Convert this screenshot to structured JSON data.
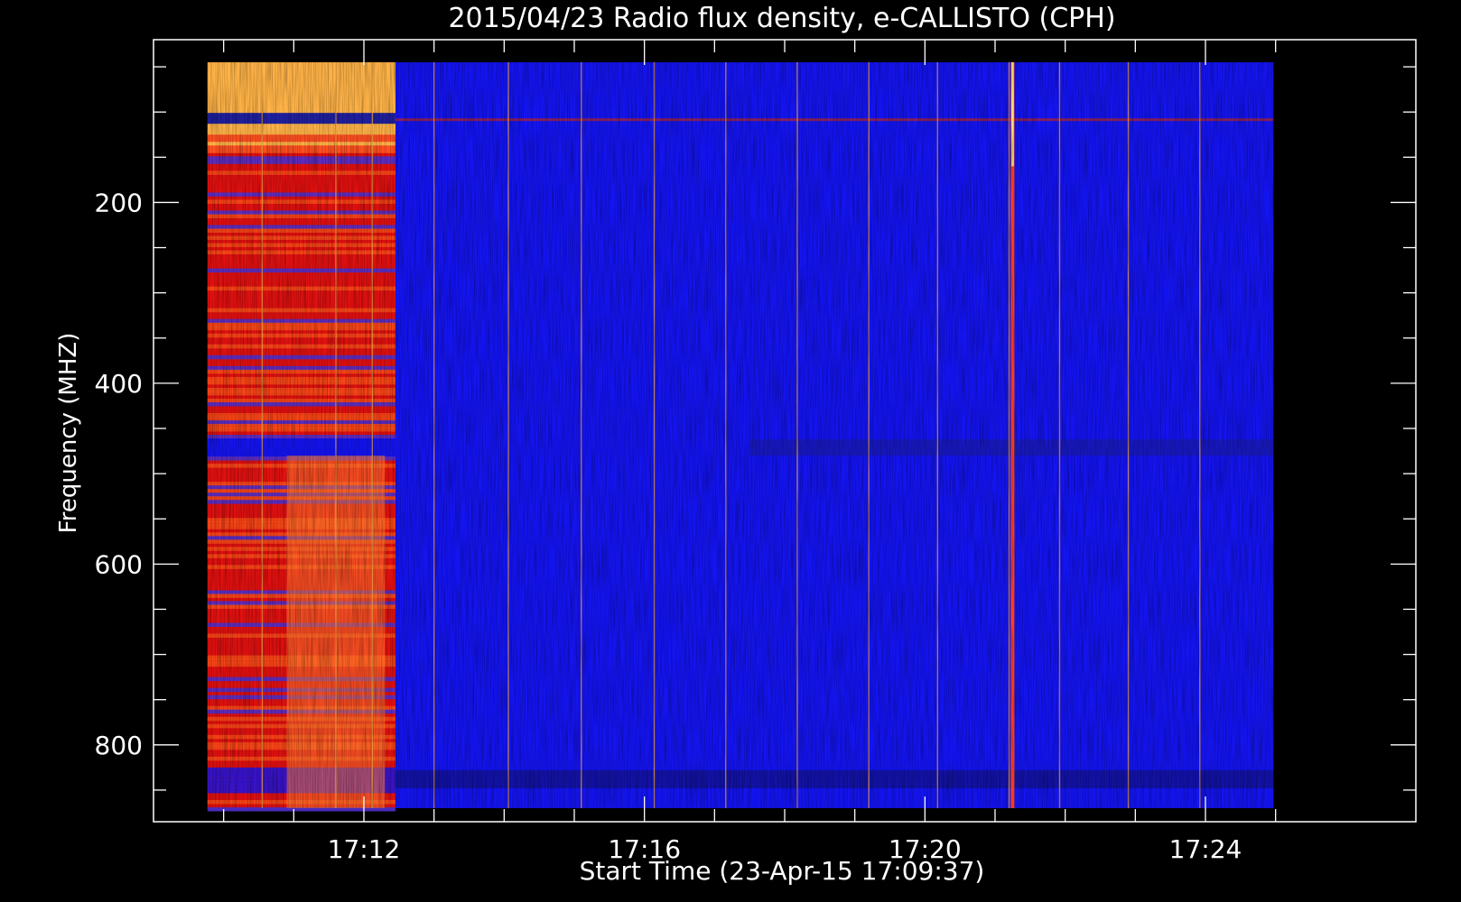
{
  "chart_data": {
    "type": "heatmap",
    "title": "2015/04/23  Radio flux density, e-CALLISTO (CPH)",
    "xlabel": "Start Time (23-Apr-15 17:09:37)",
    "ylabel": "Frequency (MHZ)",
    "x_axis_range_minutes": [
      17.0,
      35.0
    ],
    "y_axis_range_mhz": [
      20,
      885
    ],
    "y_axis_reversed": true,
    "x_ticks": [
      {
        "minute": 20,
        "label": "17:12"
      },
      {
        "minute": 24,
        "label": "17:16"
      },
      {
        "minute": 28,
        "label": "17:20"
      },
      {
        "minute": 32,
        "label": "17:24"
      }
    ],
    "y_ticks": [
      {
        "mhz": 200,
        "label": "200"
      },
      {
        "mhz": 400,
        "label": "400"
      },
      {
        "mhz": 600,
        "label": "600"
      },
      {
        "mhz": 800,
        "label": "800"
      }
    ],
    "data_extent": {
      "time_start_min": 17.77,
      "time_end_min": 32.97,
      "freq_min_mhz": 45,
      "freq_max_mhz": 870
    },
    "burst_region": {
      "time_start_min": 17.77,
      "time_end_min": 20.45,
      "description_level": "high"
    },
    "bright_vertical_lines_min": [
      18.55,
      19.6,
      20.12,
      21.0,
      22.06,
      23.1,
      24.14,
      25.16,
      26.18,
      27.2,
      28.18,
      29.2,
      29.92,
      30.9,
      31.92
    ],
    "strong_burst_line_min": 29.25,
    "grid": false,
    "colors": {
      "background": "#000000",
      "axes": "#ffffff",
      "low": "#1414f0",
      "mid": "#e01010",
      "high": "#ffb347",
      "peak": "#ffe070"
    }
  }
}
